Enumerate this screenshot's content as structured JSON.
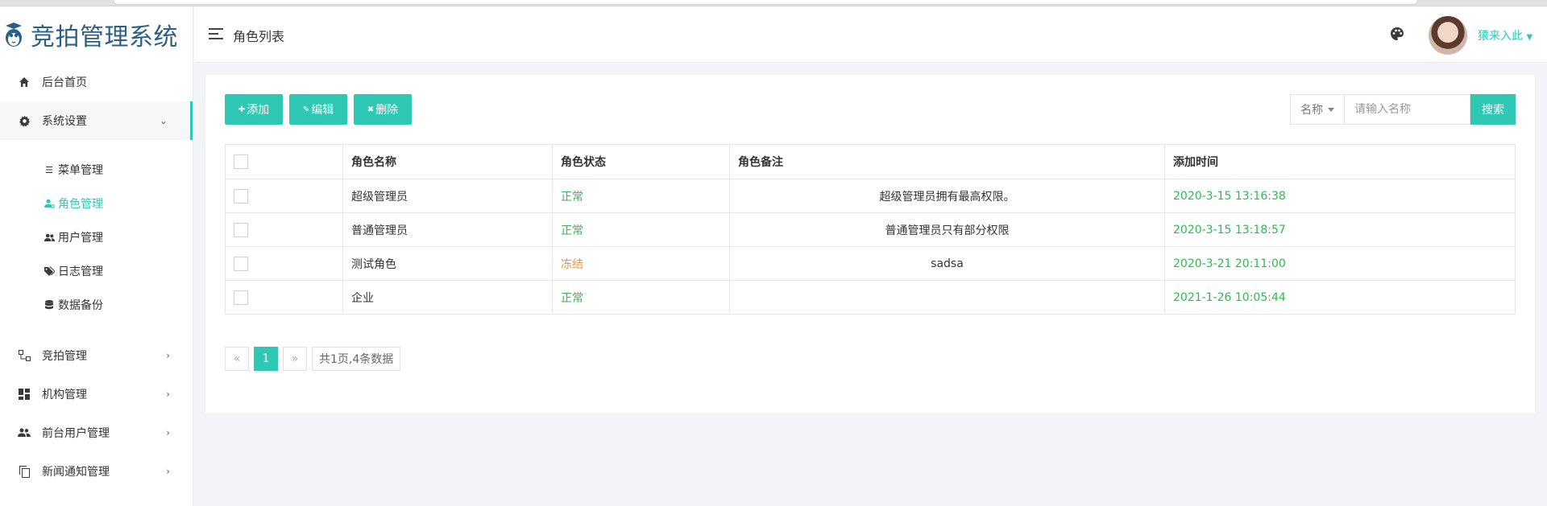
{
  "app": {
    "title": "竞拍管理系统"
  },
  "header": {
    "page_title": "角色列表",
    "username": "猿来入此"
  },
  "sidebar": {
    "items": [
      {
        "label": "后台首页",
        "icon": "home-icon"
      },
      {
        "label": "系统设置",
        "icon": "gear-icon",
        "expanded": true,
        "children": [
          {
            "label": "菜单管理",
            "icon": "list-icon"
          },
          {
            "label": "角色管理",
            "icon": "user-gear-icon",
            "active": true
          },
          {
            "label": "用户管理",
            "icon": "users-icon"
          },
          {
            "label": "日志管理",
            "icon": "tags-icon"
          },
          {
            "label": "数据备份",
            "icon": "database-icon"
          }
        ]
      },
      {
        "label": "竞拍管理",
        "icon": "hierarchy-icon"
      },
      {
        "label": "机构管理",
        "icon": "dashboard-icon"
      },
      {
        "label": "前台用户管理",
        "icon": "people-icon"
      },
      {
        "label": "新闻通知管理",
        "icon": "copy-icon"
      }
    ]
  },
  "toolbar": {
    "add_label": "添加",
    "edit_label": "编辑",
    "delete_label": "删除"
  },
  "search": {
    "field_label": "名称",
    "placeholder": "请输入名称",
    "button_label": "搜索"
  },
  "table": {
    "columns": [
      "角色名称",
      "角色状态",
      "角色备注",
      "添加时间"
    ],
    "rows": [
      {
        "name": "超级管理员",
        "status": "正常",
        "remark": "超级管理员拥有最高权限。",
        "time": "2020-3-15 13:16:38"
      },
      {
        "name": "普通管理员",
        "status": "正常",
        "remark": "普通管理员只有部分权限",
        "time": "2020-3-15 13:18:57"
      },
      {
        "name": "测试角色",
        "status": "冻结",
        "remark": "sadsa",
        "time": "2020-3-21 20:11:00"
      },
      {
        "name": "企业",
        "status": "正常",
        "remark": "",
        "time": "2021-1-26 10:05:44"
      }
    ]
  },
  "pagination": {
    "prev": "«",
    "current": "1",
    "next": "»",
    "summary": "共1页,4条数据"
  },
  "colors": {
    "accent": "#2fc8b5",
    "status_ok": "#2dbb4e",
    "status_frozen": "#f0953f",
    "logo": "#2b5f86"
  }
}
